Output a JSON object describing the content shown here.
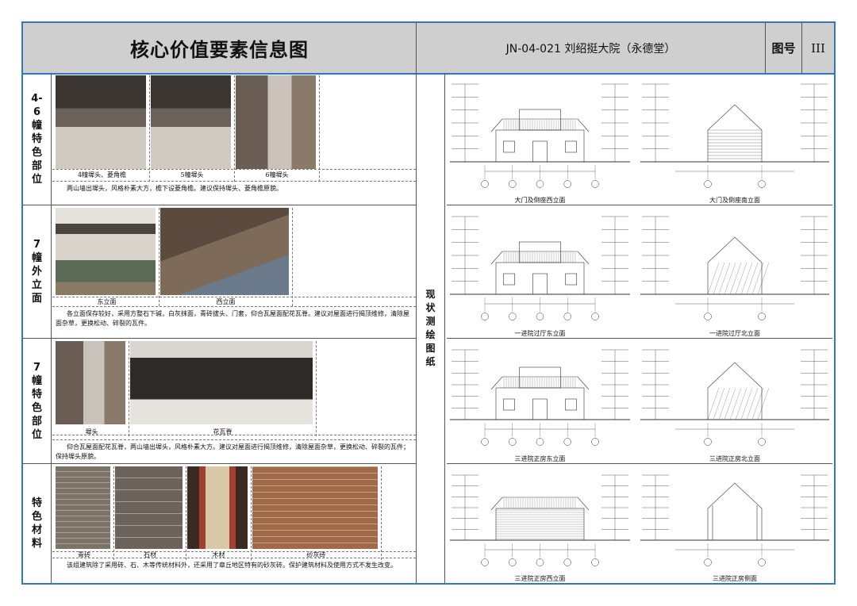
{
  "header": {
    "title": "核心价值要素信息图",
    "code": "JN-04-021 刘绍挺大院（永德堂）",
    "label": "图号",
    "number": "III"
  },
  "sections": [
    {
      "label": "4-6幢特色部位",
      "photos": [
        "4幢墀头、菱角檐",
        "5幢墀头",
        "6幢墀头"
      ],
      "desc": "两山墙出墀头，风格朴素大方，檐下设菱角檐。建议保持墀头、菱角檐原貌。"
    },
    {
      "label": "7幢外立面",
      "photos": [
        "东立面",
        "西立面"
      ],
      "desc": "各立面保存较好，采用方整石下碱，白灰抹面，青砖拔头、门套，仰合瓦屋面配花瓦脊。建议对屋面进行揭顶维修，清除屋面杂草，更换松动、碎裂的瓦件。"
    },
    {
      "label": "7幢特色部位",
      "photos": [
        "墀头",
        "花瓦脊"
      ],
      "desc": "仰合瓦屋面配花瓦脊，两山墙出墀头，风格朴素大方。建议对屋面进行揭顶维修，清除屋面杂草，更换松动、碎裂的瓦件；保持墀头原貌。"
    },
    {
      "label": "特色材料",
      "photos": [
        "青砖",
        "石材",
        "木材",
        "砂灰砖"
      ],
      "desc": "该组建筑除了采用砖、石、木等传统材料外，还采用了章丘地区特有的砂灰砖。保护建筑材料及使用方式不发生改变。"
    }
  ],
  "middle_label": "现状测绘图纸",
  "drawings": [
    [
      "大门及倒座西立面",
      "大门及倒座南立面"
    ],
    [
      "一进院过厅东立面",
      "一进院过厅北立面"
    ],
    [
      "三进院正房东立面",
      "三进院正房北立面"
    ],
    [
      "三进院正房西立面",
      "三进院正房侧面"
    ]
  ]
}
